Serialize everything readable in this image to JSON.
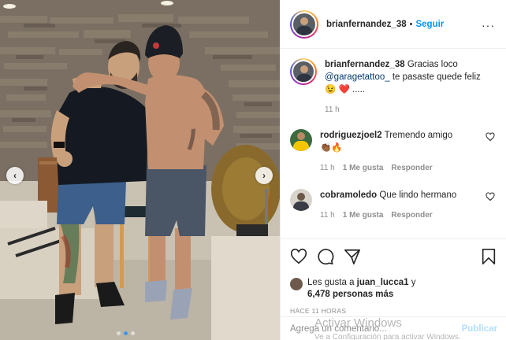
{
  "post": {
    "author": "brianfernandez_38",
    "separator": "•",
    "follow_label": "Seguir",
    "more_label": "···",
    "nav_prev": "‹",
    "nav_next": "›"
  },
  "caption": {
    "username": "brianfernandez_38",
    "text_before_mention": "Gracias loco",
    "mention": "@garagetattoo_",
    "text_after_mention": "te pasaste quede feliz",
    "emojis": "😉 ❤️ .....",
    "time": "11 h"
  },
  "comments": [
    {
      "username": "rodriguezjoel2",
      "text": "Tremendo amigo",
      "emojis": "👏🏾🔥",
      "time": "11 h",
      "likes": "1 Me gusta",
      "reply_label": "Responder"
    },
    {
      "username": "cobramoledo",
      "text": "Que lindo hermano",
      "time": "11 h",
      "likes": "1 Me gusta",
      "reply_label": "Responder"
    }
  ],
  "likes": {
    "prefix": "Les gusta a",
    "user": "juan_lucca1",
    "conj": "y",
    "count": "6,478 personas más"
  },
  "timestamp": "HACE 11 HORAS",
  "add_comment": {
    "placeholder": "Agrega un comentario...",
    "publish_label": "Publicar"
  },
  "overlay": {
    "activate_title": "Activar Windows",
    "activate_sub": "Ve a Configuración para activar Windows."
  },
  "colors": {
    "link_blue": "#0095f6",
    "mention_blue": "#00376b",
    "heart_red": "#ed4956",
    "muted": "#8e8e8e"
  },
  "carousel": {
    "active_index": 1,
    "count": 3
  }
}
